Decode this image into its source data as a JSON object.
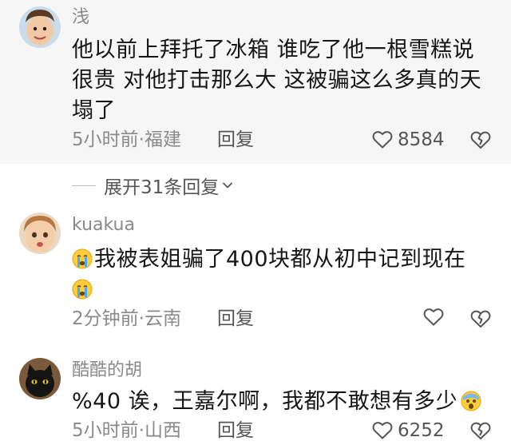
{
  "comments": [
    {
      "username": "浅",
      "text_lines": [
        "他以前上拜托了冰箱 谁吃了他一根雪糕说",
        "很贵 对他打击那么大 这被骗这么多真的天",
        "塌了"
      ],
      "time_location": "5小时前·福建",
      "reply_label": "回复",
      "like_count": "8584",
      "avatar": "child-avatar"
    },
    {
      "username": "kuakua",
      "text_lines": [
        "我被表姐骗了400块都从初中记到现在",
        ""
      ],
      "time_location": "2分钟前·云南",
      "reply_label": "回复",
      "like_count": "",
      "avatar": "child-face-avatar",
      "emoji": "crying-face-emoji"
    },
    {
      "username": "酷酷的胡",
      "text_lines": [
        "%40 诶，王嘉尔啊，我都不敢想有多少"
      ],
      "time_location": "5小时前·山西",
      "reply_label": "回复",
      "like_count": "6252",
      "avatar": "black-cat-avatar",
      "emoji": "scared-face-emoji"
    }
  ],
  "expand_replies": {
    "label": "展开31条回复"
  },
  "colors": {
    "highlight_bg": "#f6f6f6",
    "meta_text": "#8a8a8a",
    "body_text": "#161616"
  }
}
